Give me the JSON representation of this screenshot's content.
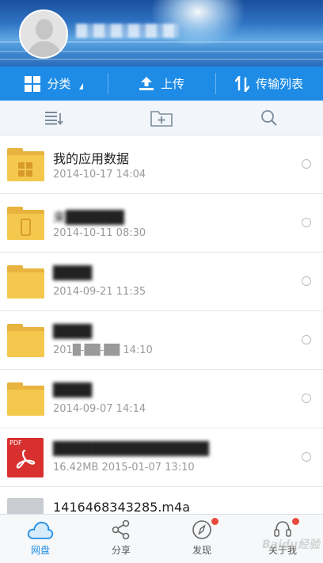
{
  "header": {
    "username": "████████"
  },
  "toolbar": {
    "category": "分类",
    "upload": "上传",
    "transfer": "传输列表"
  },
  "files": [
    {
      "name": "我的应用数据",
      "meta": "2014-10-17  14:04",
      "type": "folder-app"
    },
    {
      "name": "来██████",
      "meta": "2014-10-11  08:30",
      "type": "folder-device"
    },
    {
      "name": "████",
      "meta": "2014-09-21  11:35",
      "type": "folder"
    },
    {
      "name": "████",
      "meta": "201█-██-██  14:10",
      "type": "folder"
    },
    {
      "name": "████",
      "meta": "2014-09-07  14:14",
      "type": "folder"
    },
    {
      "name": "████████████████",
      "meta": "16.42MB   2015-01-07  13:10",
      "type": "pdf"
    },
    {
      "name": "1416468343285.m4a",
      "meta": "",
      "type": "audio"
    }
  ],
  "pdf_badge": "PDF",
  "nav": {
    "netdisk": "网盘",
    "share": "分享",
    "discover": "发现",
    "about": "关于我"
  },
  "watermark": "Baidu经验",
  "colors": {
    "accent": "#1e8ce6",
    "folder": "#f4c84d",
    "pdf": "#d8302e",
    "badge": "#e94b3c"
  }
}
